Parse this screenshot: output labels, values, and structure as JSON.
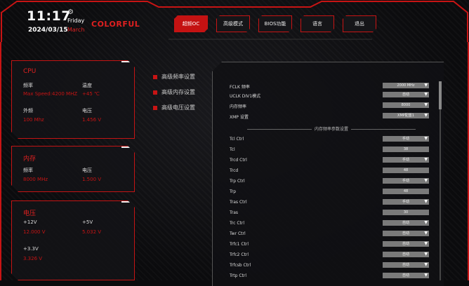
{
  "clock": {
    "time": "11:17",
    "day": "Friday",
    "month": "March",
    "date": "2024/03/15"
  },
  "brand": "COLORFUL",
  "nav": [
    {
      "label": "超频OC",
      "active": true
    },
    {
      "label": "高级模式",
      "active": false
    },
    {
      "label": "BIOS功能",
      "active": false
    },
    {
      "label": "语言",
      "active": false
    },
    {
      "label": "退出",
      "active": false
    }
  ],
  "cpu": {
    "title": "CPU",
    "freq_label": "频率",
    "freq_value": "Max Speed:4200 MHZ",
    "temp_label": "温度",
    "temp_value": "+45 ℃",
    "ext_label": "外频",
    "ext_value": "100 Mhz",
    "volt_label": "电压",
    "volt_value": "1.456 V"
  },
  "memory": {
    "title": "内存",
    "freq_label": "频率",
    "freq_value": "8000 MHz",
    "volt_label": "电压",
    "volt_value": "1.500 V"
  },
  "voltage": {
    "title": "电压",
    "v12_label": "+12V",
    "v12_value": "12.000 V",
    "v5_label": "+5V",
    "v5_value": "5.032 V",
    "v33_label": "+3.3V",
    "v33_value": "3.326 V"
  },
  "menu": [
    "高级频率设置",
    "高级内存设置",
    "高级电压设置"
  ],
  "settings_top": [
    {
      "label": "FCLK 频率",
      "value": "2000 MHz"
    },
    {
      "label": "UCLK DIV1模式",
      "value": "自动"
    },
    {
      "label": "内存频率",
      "value": "8000"
    },
    {
      "label": "XMP 设置",
      "value": "XMP配置1"
    }
  ],
  "section_title": "内存频率参数设置",
  "settings_timing": [
    {
      "label": "Tcl Ctrl",
      "value": "手动"
    },
    {
      "label": "Tcl",
      "value": "38"
    },
    {
      "label": "Trcd Ctrl",
      "value": "手动"
    },
    {
      "label": "Trcd",
      "value": "48"
    },
    {
      "label": "Trp Ctrl",
      "value": "手动"
    },
    {
      "label": "Trp",
      "value": "48"
    },
    {
      "label": "Tras Ctrl",
      "value": "手动"
    },
    {
      "label": "Tras",
      "value": "30"
    },
    {
      "label": "Trc Ctrl",
      "value": "自动"
    },
    {
      "label": "Twr Ctrl",
      "value": "自动"
    },
    {
      "label": "Trfc1 Ctrl",
      "value": "自动"
    },
    {
      "label": "Trfc2 Ctrl",
      "value": "自动"
    },
    {
      "label": "Trfcsb Ctrl",
      "value": "自动"
    },
    {
      "label": "Trtp Ctrl",
      "value": "自动"
    }
  ]
}
